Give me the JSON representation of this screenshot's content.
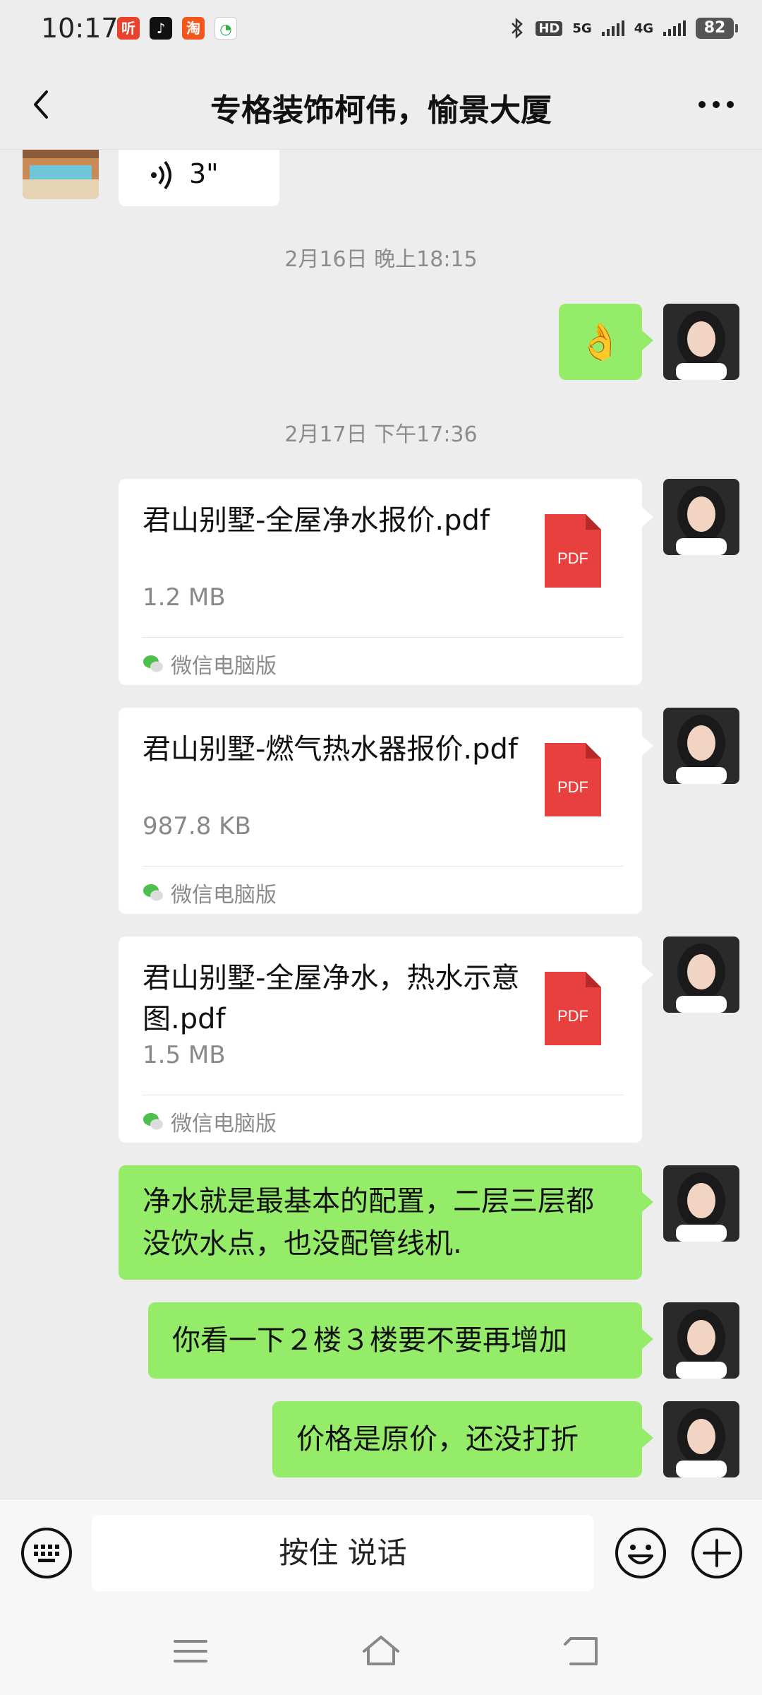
{
  "status_bar": {
    "time": "10:17",
    "app_icons": [
      {
        "name": "ting-app-icon",
        "glyph": "听",
        "color": "#e8412c"
      },
      {
        "name": "tiktok-app-icon",
        "glyph": "♪",
        "color": "#111111"
      },
      {
        "name": "taobao-app-icon",
        "glyph": "淘",
        "color": "#f2561d"
      },
      {
        "name": "chat-app-icon",
        "glyph": "◔",
        "color": "#2bb24c"
      }
    ],
    "hd_label": "HD",
    "network_5g": "5G",
    "network_4g": "4G",
    "battery": "82"
  },
  "header": {
    "title": "专格装饰柯伟，愉景大厦"
  },
  "messages": {
    "voice_duration": "3\"",
    "time_1": "2月16日 晚上18:15",
    "emoji": "👌",
    "time_2": "2月17日 下午17:36",
    "files": [
      {
        "name": "君山别墅-全屋净水报价.pdf",
        "size": "1.2 MB",
        "icon_label": "PDF",
        "source": "微信电脑版"
      },
      {
        "name": "君山别墅-燃气热水器报价.pdf",
        "size": "987.8 KB",
        "icon_label": "PDF",
        "source": "微信电脑版"
      },
      {
        "name": "君山别墅-全屋净水，热水示意图.pdf",
        "size": "1.5 MB",
        "icon_label": "PDF",
        "source": "微信电脑版"
      }
    ],
    "text_1": "净水就是最基本的配置，二层三层都没饮水点，也没配管线机.",
    "text_2": "你看一下２楼３楼要不要再增加",
    "text_3": "价格是原价，还没打折"
  },
  "input_bar": {
    "voice_label": "按住 说话"
  },
  "colors": {
    "bubble_green": "#95ec69",
    "pdf_red": "#e8403f",
    "background": "#ededed"
  }
}
